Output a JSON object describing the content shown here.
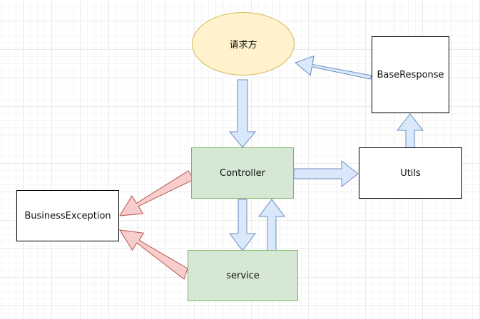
{
  "diagram": {
    "nodes": {
      "requester": {
        "label": "请求方",
        "fill": "#fff2cc",
        "stroke": "#d6b656"
      },
      "base_response": {
        "label": "BaseResponse",
        "fill": "#ffffff",
        "stroke": "#000000"
      },
      "controller": {
        "label": "Controller",
        "fill": "#d5e8d4",
        "stroke": "#82b366"
      },
      "utils": {
        "label": "Utils",
        "fill": "#ffffff",
        "stroke": "#000000"
      },
      "business_exception": {
        "label": "BusinessException",
        "fill": "#ffffff",
        "stroke": "#000000"
      },
      "service": {
        "label": "service",
        "fill": "#d5e8d4",
        "stroke": "#82b366"
      }
    },
    "edges": [
      {
        "from": "base_response",
        "to": "requester",
        "color": "blue"
      },
      {
        "from": "requester",
        "to": "controller",
        "color": "blue"
      },
      {
        "from": "controller",
        "to": "utils",
        "color": "blue"
      },
      {
        "from": "utils",
        "to": "base_response",
        "color": "blue"
      },
      {
        "from": "controller",
        "to": "service",
        "color": "blue"
      },
      {
        "from": "service",
        "to": "controller",
        "color": "blue"
      },
      {
        "from": "controller",
        "to": "business_exception",
        "color": "red"
      },
      {
        "from": "service",
        "to": "business_exception",
        "color": "red"
      }
    ],
    "arrow_colors": {
      "blue": {
        "fill": "#dae8fc",
        "stroke": "#6c8ebf"
      },
      "red": {
        "fill": "#f8cecc",
        "stroke": "#b85450"
      }
    }
  }
}
